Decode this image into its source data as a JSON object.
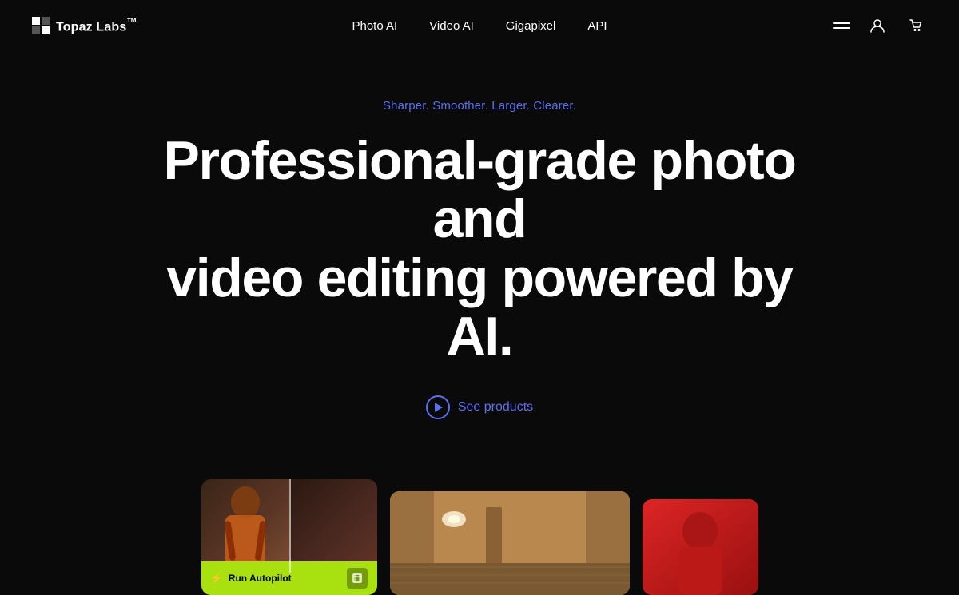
{
  "nav": {
    "logo_text": "Topaz Labs",
    "logo_tm": "™",
    "links": [
      {
        "label": "Photo AI",
        "id": "photo-ai"
      },
      {
        "label": "Video AI",
        "id": "video-ai"
      },
      {
        "label": "Gigapixel",
        "id": "gigapixel"
      },
      {
        "label": "API",
        "id": "api"
      }
    ]
  },
  "hero": {
    "tagline": "Sharper. Smoother. Larger. Clearer.",
    "title_line1": "Professional-grade photo and",
    "title_line2": "video editing powered by AI.",
    "cta_label": "See products"
  },
  "preview": {
    "autopilot_label": "Run Autopilot"
  },
  "colors": {
    "background": "#0a0a0a",
    "accent_blue": "#5b6ff0",
    "accent_green": "#a8e010",
    "white": "#ffffff"
  }
}
